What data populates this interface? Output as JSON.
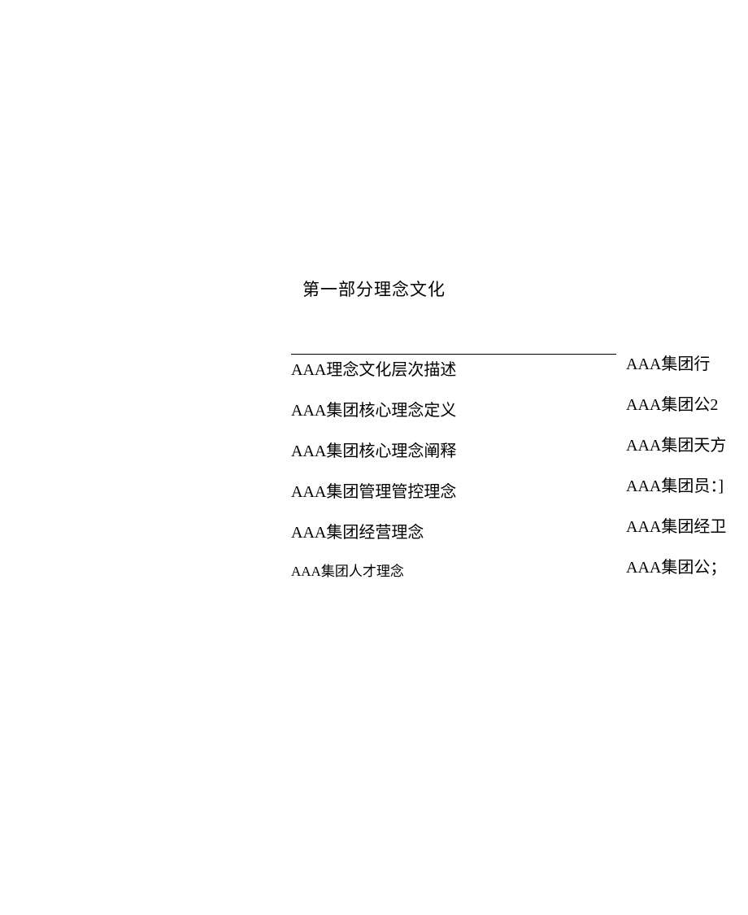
{
  "heading": "第一部分理念文化",
  "left_column": [
    {
      "text": "AAA理念文化层次描述",
      "small": false
    },
    {
      "text": "AAA集团核心理念定义",
      "small": false
    },
    {
      "text": "AAA集团核心理念阐释",
      "small": false
    },
    {
      "text": "AAA集团管理管控理念",
      "small": false
    },
    {
      "text": "AAA集团经营理念",
      "small": false
    },
    {
      "text": "AAA集团人才理念",
      "small": true
    }
  ],
  "right_column": [
    "AAA集团行",
    "AAA集团公2",
    "AAA集团天方",
    "AAA集团员：]",
    "AAA集团经卫",
    "AAA集团公；"
  ]
}
